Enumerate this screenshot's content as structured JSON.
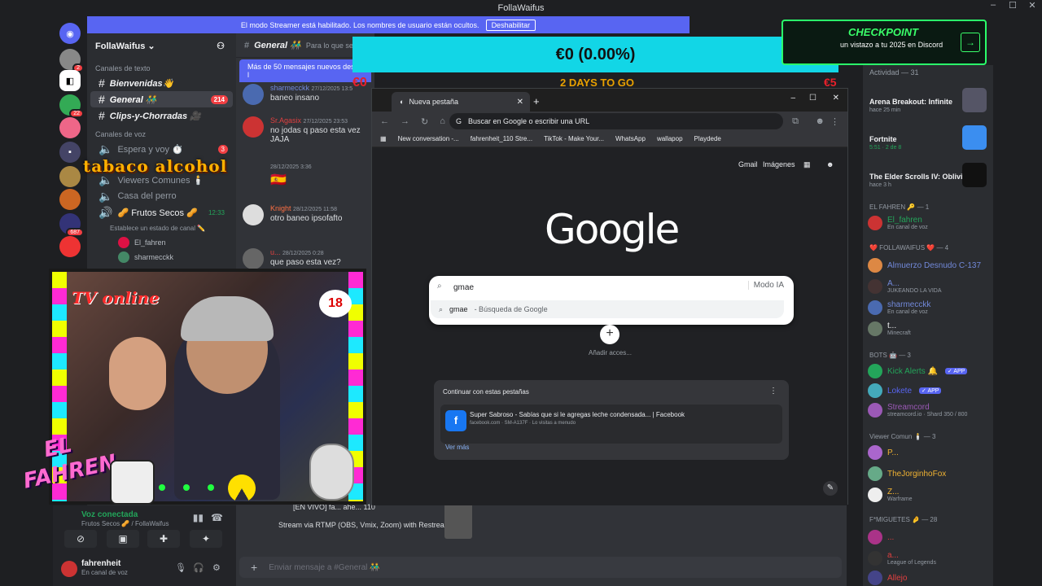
{
  "app": {
    "title": "FollaWaifus",
    "window_controls": [
      "–",
      "☐",
      "✕"
    ]
  },
  "banner": {
    "text": "El modo Streamer está habilitado. Los nombres de usuario están ocultos.",
    "button": "Deshabilitar"
  },
  "server": {
    "name": "FollaWaifus ⌄"
  },
  "sidebar": {
    "cat_text": "Canales de texto",
    "channels": [
      {
        "label": "Bienvenidas👋"
      },
      {
        "label": "General 👬",
        "count": "214"
      },
      {
        "label": "Clips-y-Chorradas 🎥"
      }
    ],
    "cat_voice": "Canales de voz",
    "voice": [
      {
        "label": "Espera y voy ⏱️",
        "count": "3"
      },
      {
        "label": "Viewers Comunes 🕯️"
      },
      {
        "label": "Casa del perro"
      },
      {
        "label": "🥜 Frutos Secos 🥜",
        "time": "12:33"
      }
    ],
    "voice_status": "Establece un estado de canal ✏️",
    "voice_members": [
      "El_fahren",
      "sharmecckk"
    ]
  },
  "chat": {
    "channel": "General 👬",
    "topic": "Para lo que se t",
    "newbar": "Más de 50 mensajes nuevos desde l",
    "messages": [
      {
        "author": "sharmecckk",
        "time": "27/12/2025 13:5",
        "text": "baneo insano",
        "color": "#7289da"
      },
      {
        "author": "Sr.Agasix",
        "time": "27/12/2025 23:53",
        "text": "no jodas q paso esta vez JAJA",
        "color": "#e04040"
      },
      {
        "author": "",
        "time": "28/12/2025 3:36",
        "text": "🇪🇸",
        "color": "#fff"
      },
      {
        "author": "Knight",
        "time": "28/12/2025 11:58",
        "text": "otro baneo ipsofafto",
        "color": "#ff7043"
      },
      {
        "author": "u...",
        "time": "28/12/2025 0:28",
        "text": "que paso esta vez?",
        "color": "#e04040"
      }
    ],
    "live_text": "[EN VIVO] fa... ahe... 110",
    "rtmp": "Stream via RTMP (OBS, Vmix, Zoom) with Restream",
    "placeholder": "Enviar mensaje a #General 👬"
  },
  "overlay": {
    "goal": "€0 (0.00%)",
    "left": "€0",
    "right": "€5",
    "days": "2 DAYS TO GO",
    "tabaco": "tabaco alcohol",
    "tv_online": "TV online",
    "age": "18",
    "brand1": "EL",
    "brand2": "FAHREN"
  },
  "voicebar": {
    "label": "Voz conectada",
    "sub": "Frutos Secos 🥜 / FollaWaifus"
  },
  "user": {
    "name": "fahrenheit",
    "status": "En canal de voz"
  },
  "checkpoint": {
    "title": "CHECKPOINT",
    "sub": "un vistazo a tu 2025 en Discord"
  },
  "right": {
    "activity_head": "Actividad — 31",
    "activity": [
      {
        "name": "Arena Breakout: Infinite",
        "meta": "hace 25 min"
      },
      {
        "name": "Fortnite",
        "meta": "5:51 · 2 de 8"
      },
      {
        "name": "The Elder Scrolls IV: Oblivi...",
        "meta": "hace 3 h"
      }
    ],
    "groups": [
      {
        "title": "EL FAHREN 🔑 — 1",
        "members": [
          {
            "name": "El_fahren",
            "sub": "En canal de voz",
            "color": "#23a55a"
          }
        ]
      },
      {
        "title": "❤️ FOLLAWAIFUS ❤️ — 4",
        "members": [
          {
            "name": "Almuerzo Desnudo C-137",
            "sub": "",
            "color": "#7289da"
          },
          {
            "name": "A...",
            "sub": "JUKEANDO LA VIDA",
            "color": "#7289da"
          },
          {
            "name": "sharmecckk",
            "sub": "En canal de voz",
            "color": "#7289da"
          },
          {
            "name": "t...",
            "sub": "Minecraft",
            "color": "#f2f3f5"
          }
        ]
      },
      {
        "title": "BOTS 🤖 — 3",
        "members": [
          {
            "name": "Kick Alerts 🔔",
            "sub": "",
            "color": "#23a55a"
          },
          {
            "name": "Lokete",
            "sub": "",
            "color": "#5865f2"
          },
          {
            "name": "Streamcord",
            "sub": "streamcord.io · Shard 350 / 800",
            "color": "#9b59b6"
          }
        ]
      },
      {
        "title": "Viewer Comun 🕯️ — 3",
        "members": [
          {
            "name": "P...",
            "sub": "",
            "color": "#f0b232"
          },
          {
            "name": "TheJorginhoFox",
            "sub": "",
            "color": "#f0b232"
          },
          {
            "name": "Z...",
            "sub": "Warframe",
            "color": "#f0b232"
          }
        ]
      },
      {
        "title": "F*MIGUETES 🤌 — 28",
        "members": [
          {
            "name": "...",
            "sub": "",
            "color": "#e04040"
          },
          {
            "name": "a...",
            "sub": "League of Legends",
            "color": "#e04040"
          },
          {
            "name": "Allejo",
            "sub": "",
            "color": "#e04040"
          }
        ]
      }
    ]
  },
  "browser": {
    "tab": "Nueva pestaña",
    "omnibox": "Buscar en Google o escribir una URL",
    "bookmarks": [
      "New conversation -...",
      "fahrenheit_110 Stre...",
      "TikTok - Make Your...",
      "WhatsApp",
      "wallapop",
      "Playdede"
    ],
    "gmail": "Gmail",
    "images": "Imágenes",
    "logo": "Google",
    "query": "gmae",
    "ai_mode": "Modo IA",
    "suggestion_q": "gmae",
    "suggestion_t": "- Búsqueda de Google",
    "add_label": "Añadir acces...",
    "continue_head": "Continuar con estas pestañas",
    "card_title": "Super Sabroso - Sabías que si le agregas leche condensada... | Facebook",
    "card_url": "facebook.com · SM-A137F · Lo visitas a menudo",
    "more": "Ver más"
  }
}
